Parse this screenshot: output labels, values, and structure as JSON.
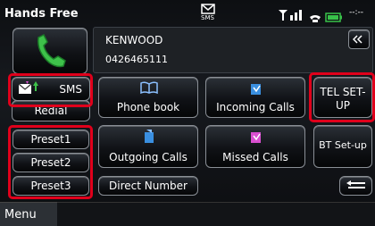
{
  "header": {
    "title": "Hands Free",
    "sms_icon_label": "SMS",
    "signal_text": "Till",
    "handset_icon": "phone-handset-icon",
    "battery_icon": "battery-icon",
    "network_text": "--:--"
  },
  "call_info": {
    "name": "KENWOOD",
    "number": "0426465111",
    "call_icon": "phone-call-icon",
    "scroll_icon": "double-chevron-icon"
  },
  "buttons": {
    "sms": {
      "label": "SMS",
      "icon": "sms-icon"
    },
    "redial": {
      "label": "Redial"
    },
    "phone_book": {
      "label": "Phone book",
      "icon": "book-icon"
    },
    "incoming_calls": {
      "label": "Incoming Calls",
      "icon": "incoming-call-icon"
    },
    "tel_setup": {
      "label_line1": "TEL SET-",
      "label_line2": "UP"
    },
    "preset1": {
      "label": "Preset1"
    },
    "preset2": {
      "label": "Preset2"
    },
    "preset3": {
      "label": "Preset3"
    },
    "outgoing_calls": {
      "label": "Outgoing Calls",
      "icon": "outgoing-call-icon"
    },
    "missed_calls": {
      "label": "Missed Calls",
      "icon": "missed-call-icon"
    },
    "bt_setup": {
      "label": "BT Set-up"
    },
    "direct_number": {
      "label": "Direct Number"
    },
    "back": {
      "icon": "return-arrow-icon"
    }
  },
  "footer": {
    "menu_label": "Menu"
  },
  "colors": {
    "highlight": "#e0001b",
    "accent_green": "#3ec24a",
    "icon_pink": "#d94fd0",
    "icon_blue": "#3a8fe0"
  }
}
